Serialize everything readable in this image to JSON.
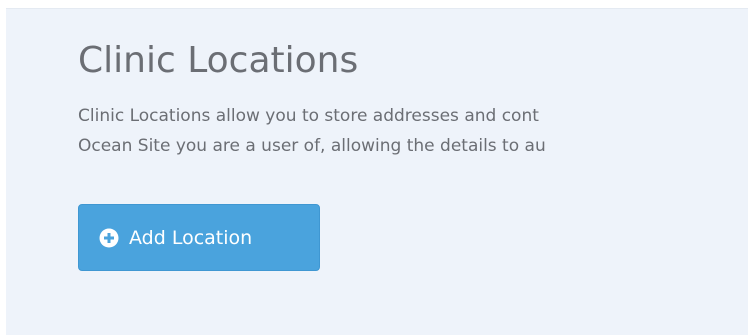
{
  "header": {
    "title": "Clinic Locations"
  },
  "description": {
    "line1": "Clinic Locations allow you to store addresses and cont",
    "line2": "Ocean Site you are a user of, allowing the details to au"
  },
  "actions": {
    "add_location_label": "Add Location",
    "add_location_icon": "plus-circle-icon"
  },
  "colors": {
    "panel_background": "#eef3fa",
    "button_background": "#4aa3dd",
    "text": "#6b6e74"
  }
}
